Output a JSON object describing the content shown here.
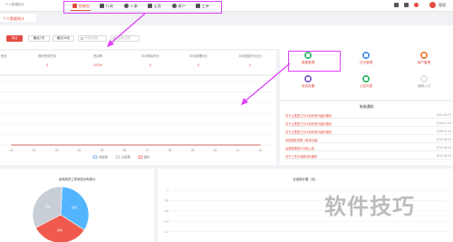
{
  "topnav": {
    "items": [
      {
        "label": "控制台",
        "icon": "home-icon"
      },
      {
        "label": "行政",
        "icon": "briefcase-icon"
      },
      {
        "label": "人事",
        "icon": "person-icon"
      },
      {
        "label": "运营",
        "icon": "document-icon"
      },
      {
        "label": "客户",
        "icon": "person-icon"
      },
      {
        "label": "工单",
        "icon": "document-icon"
      }
    ],
    "user_name": "管理"
  },
  "page_tab": "个人数据统计",
  "toolbar": {
    "buttons": [
      "本日",
      "最近7天",
      "最近30天"
    ],
    "start_placeholder": "开始日期",
    "end_placeholder": "结束日期"
  },
  "stats": [
    {
      "label": "任务",
      "value": ""
    },
    {
      "label": "按时完成任务",
      "value": "0"
    },
    {
      "label": "完成率",
      "value": "100%"
    },
    {
      "label": "平均响应时长",
      "value": "0"
    },
    {
      "label": "平均处理时长",
      "value": "0"
    },
    {
      "label": "平均回复时长(分)",
      "value": "0"
    }
  ],
  "quick_links": [
    {
      "label": "数据管理",
      "color": "#34b86c"
    },
    {
      "label": "日志管理",
      "color": "#4a90e2"
    },
    {
      "label": "客户管理",
      "color": "#f0803c"
    },
    {
      "label": "系统设置",
      "color": "#7b61c9"
    },
    {
      "label": "公告列表",
      "color": "#34b86c"
    },
    {
      "label": "编辑入口",
      "color": "#e0e0e0"
    }
  ],
  "notices": {
    "title": "系统通知",
    "items": [
      {
        "title": "关于云里里工作计划系统升级的通知",
        "date": "2020-03-27"
      },
      {
        "title": "关于云里里工作计划系统升级的通知",
        "date": "2019-12-19"
      },
      {
        "title": "关于云里里工作计划系统升级的通知",
        "date": "2019-11-19"
      },
      {
        "title": "系统更新说明（新增功能）",
        "date": "2019-08-14"
      },
      {
        "title": "运营数据统计功能上线",
        "date": "2019-08-14"
      },
      {
        "title": "关于工作计划模块的通知",
        "date": "2019-06-14"
      }
    ]
  },
  "chart_data": [
    {
      "type": "line",
      "title": "",
      "x": [
        "01",
        "02",
        "03",
        "04",
        "05",
        "06",
        "07",
        "08",
        "09",
        "10",
        "11",
        "12"
      ],
      "series": [
        {
          "name": "待处理",
          "values": [
            0,
            0,
            0,
            0,
            0,
            0,
            0,
            0,
            0,
            0,
            0,
            0
          ],
          "color": "#4a90e2"
        },
        {
          "name": "已处理",
          "values": [
            0,
            0,
            0,
            0,
            0,
            0,
            0,
            0,
            0,
            0,
            0,
            0
          ],
          "color": "#aaaaaa"
        },
        {
          "name": "超时",
          "values": [
            0,
            0,
            0,
            0,
            0,
            0,
            0,
            0,
            0,
            0,
            0,
            0
          ],
          "color": "#e54d42"
        }
      ],
      "grid": true,
      "legend": "bottom"
    },
    {
      "type": "pie",
      "title": "全体成员工作状态分布统计",
      "slices": [
        {
          "label": "0%",
          "value": 33.3,
          "color": "#54b5ff"
        },
        {
          "label": "0%",
          "value": 33.3,
          "color": "#f05a4e"
        },
        {
          "label": "0%",
          "value": 33.4,
          "color": "#c8ced6"
        }
      ]
    },
    {
      "type": "bar",
      "title": "业绩统计图（月）",
      "categories": [],
      "values": [],
      "yticks": [
        "1",
        "0.8",
        "0.6",
        "0.4",
        "0.2"
      ],
      "grid": true
    }
  ],
  "watermark": "软件技巧"
}
